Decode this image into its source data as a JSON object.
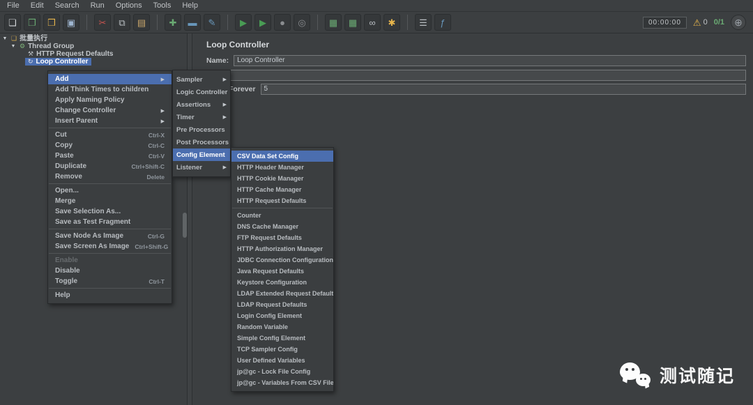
{
  "menubar": {
    "items": [
      {
        "name": "menu-file",
        "label": "File"
      },
      {
        "name": "menu-edit",
        "label": "Edit"
      },
      {
        "name": "menu-search",
        "label": "Search"
      },
      {
        "name": "menu-run",
        "label": "Run"
      },
      {
        "name": "menu-options",
        "label": "Options"
      },
      {
        "name": "menu-tools",
        "label": "Tools"
      },
      {
        "name": "menu-help",
        "label": "Help"
      }
    ]
  },
  "toolbar": {
    "timer": "00:00:00",
    "warning_count": "0",
    "threads": "0/1",
    "buttons": [
      {
        "name": "new-file-button",
        "icon": "new-file-icon",
        "glyph": "❏",
        "color": "#d4d7da"
      },
      {
        "name": "templates-button",
        "icon": "templates-icon",
        "glyph": "❐",
        "color": "#6aab73"
      },
      {
        "name": "open-file-button",
        "icon": "open-folder-icon",
        "glyph": "❒",
        "color": "#e8b64c"
      },
      {
        "name": "save-button",
        "icon": "save-icon",
        "glyph": "▣",
        "color": "#9fb6d0"
      },
      {
        "separator": true
      },
      {
        "name": "cut-button",
        "icon": "scissors-icon",
        "glyph": "✂",
        "color": "#c75450"
      },
      {
        "name": "copy-button",
        "icon": "copy-icon",
        "glyph": "⧉",
        "color": "#b9bec3"
      },
      {
        "name": "paste-button",
        "icon": "paste-icon",
        "glyph": "▤",
        "color": "#c9a66b"
      },
      {
        "separator": true
      },
      {
        "name": "add-button",
        "icon": "plus-icon",
        "glyph": "✚",
        "color": "#6aab73"
      },
      {
        "name": "remove-button",
        "icon": "minus-icon",
        "glyph": "▬",
        "color": "#6897bb"
      },
      {
        "name": "edit-button",
        "icon": "pencil-icon",
        "glyph": "✎",
        "color": "#6897bb"
      },
      {
        "separator": true
      },
      {
        "name": "start-button",
        "icon": "start-icon",
        "glyph": "▶",
        "color": "#499c54"
      },
      {
        "name": "start-no-pauses-button",
        "icon": "start-no-pauses-icon",
        "glyph": "▶",
        "color": "#499c54"
      },
      {
        "name": "stop-button",
        "icon": "stop-icon",
        "glyph": "●",
        "color": "#8a8d90"
      },
      {
        "name": "shutdown-button",
        "icon": "shutdown-icon",
        "glyph": "◎",
        "color": "#8a8d90"
      },
      {
        "separator": true
      },
      {
        "name": "remote-start-button",
        "icon": "remote-start-icon",
        "glyph": "▦",
        "color": "#6aab73"
      },
      {
        "name": "remote-start-all-button",
        "icon": "remote-start-all-icon",
        "glyph": "▦",
        "color": "#6aab73"
      },
      {
        "name": "search-button",
        "icon": "binoculars-icon",
        "glyph": "∞",
        "color": "#b9bec3"
      },
      {
        "name": "search-reset-button",
        "icon": "brush-icon",
        "glyph": "✱",
        "color": "#e8b64c"
      },
      {
        "separator": true
      },
      {
        "name": "clear-button",
        "icon": "clear-icon",
        "glyph": "☰",
        "color": "#b9bec3"
      },
      {
        "name": "function-helper-button",
        "icon": "function-helper-icon",
        "glyph": "ƒ",
        "color": "#6897bb"
      }
    ]
  },
  "icons": {
    "submenu_arrow": "▶",
    "warning": "⚠",
    "globe": "⊕"
  },
  "tree": {
    "items": [
      {
        "name": "tree-item-test-plan",
        "icon_name": "test-plan-icon",
        "twisty": "▼",
        "glyph": "❏",
        "color": "#d0a94f",
        "label": "批量执行",
        "indent": 0
      },
      {
        "name": "tree-item-thread-group",
        "icon_name": "thread-group-icon",
        "twisty": "▼",
        "glyph": "⚙",
        "color": "#7fb37a",
        "label": "Thread Group",
        "indent": 1
      },
      {
        "name": "tree-item-http-request-defaults",
        "icon_name": "http-request-defaults-icon",
        "twisty": "",
        "glyph": "⚒",
        "color": "#b9bec3",
        "label": "HTTP Request Defaults",
        "indent": 2
      },
      {
        "name": "tree-item-loop-controller",
        "icon_name": "loop-controller-icon",
        "twisty": "",
        "glyph": "↻",
        "color": "#e8e8e8",
        "label": "Loop Controller",
        "indent": 2,
        "selected": true
      }
    ]
  },
  "main": {
    "title": "Loop Controller",
    "name_label": "Name:",
    "name_value": "Loop Controller",
    "comments_value": "",
    "forever_label": "Forever",
    "loop_count_value": "5"
  },
  "context_menu": {
    "items": [
      {
        "name": "menu-item-add",
        "label": "Add",
        "submenu": true,
        "highlighted": true
      },
      {
        "name": "menu-item-add-think-times",
        "label": "Add Think Times to children"
      },
      {
        "name": "menu-item-apply-naming-policy",
        "label": "Apply Naming Policy"
      },
      {
        "name": "menu-item-change-controller",
        "label": "Change Controller",
        "submenu": true
      },
      {
        "name": "menu-item-insert-parent",
        "label": "Insert Parent",
        "submenu": true
      },
      {
        "separator": true
      },
      {
        "name": "menu-item-cut",
        "label": "Cut",
        "shortcut": "Ctrl-X"
      },
      {
        "name": "menu-item-copy",
        "label": "Copy",
        "shortcut": "Ctrl-C"
      },
      {
        "name": "menu-item-paste",
        "label": "Paste",
        "shortcut": "Ctrl-V"
      },
      {
        "name": "menu-item-duplicate",
        "label": "Duplicate",
        "shortcut": "Ctrl+Shift-C"
      },
      {
        "name": "menu-item-remove",
        "label": "Remove",
        "shortcut": "Delete"
      },
      {
        "separator": true
      },
      {
        "name": "menu-item-open",
        "label": "Open..."
      },
      {
        "name": "menu-item-merge",
        "label": "Merge"
      },
      {
        "name": "menu-item-save-selection-as",
        "label": "Save Selection As..."
      },
      {
        "name": "menu-item-save-as-test-fragment",
        "label": "Save as Test Fragment"
      },
      {
        "separator": true
      },
      {
        "name": "menu-item-save-node-as-image",
        "label": "Save Node As Image",
        "shortcut": "Ctrl-G"
      },
      {
        "name": "menu-item-save-screen-as-image",
        "label": "Save Screen As Image",
        "shortcut": "Ctrl+Shift-G"
      },
      {
        "separator": true
      },
      {
        "name": "menu-item-enable",
        "label": "Enable",
        "disabled": true
      },
      {
        "name": "menu-item-disable",
        "label": "Disable"
      },
      {
        "name": "menu-item-toggle",
        "label": "Toggle",
        "shortcut": "Ctrl-T"
      },
      {
        "separator": true
      },
      {
        "name": "menu-item-help",
        "label": "Help"
      }
    ]
  },
  "add_submenu": {
    "items": [
      {
        "name": "menu-item-sampler",
        "label": "Sampler",
        "submenu": true
      },
      {
        "name": "menu-item-logic-controller",
        "label": "Logic Controller",
        "submenu": true
      },
      {
        "name": "menu-item-assertions",
        "label": "Assertions",
        "submenu": true
      },
      {
        "name": "menu-item-timer",
        "label": "Timer",
        "submenu": true
      },
      {
        "name": "menu-item-pre-processors",
        "label": "Pre Processors",
        "submenu": true
      },
      {
        "name": "menu-item-post-processors",
        "label": "Post Processors",
        "submenu": true
      },
      {
        "name": "menu-item-config-element",
        "label": "Config Element",
        "submenu": true,
        "highlighted": true
      },
      {
        "name": "menu-item-listener",
        "label": "Listener",
        "submenu": true
      }
    ]
  },
  "config_submenu": {
    "items": [
      {
        "name": "menu-item-csv-data-set-config",
        "label": "CSV Data Set Config",
        "highlighted": true
      },
      {
        "name": "menu-item-http-header-manager",
        "label": "HTTP Header Manager"
      },
      {
        "name": "menu-item-http-cookie-manager",
        "label": "HTTP Cookie Manager"
      },
      {
        "name": "menu-item-http-cache-manager",
        "label": "HTTP Cache Manager"
      },
      {
        "name": "menu-item-http-request-defaults",
        "label": "HTTP Request Defaults"
      },
      {
        "separator": true
      },
      {
        "name": "menu-item-counter",
        "label": "Counter"
      },
      {
        "name": "menu-item-dns-cache-manager",
        "label": "DNS Cache Manager"
      },
      {
        "name": "menu-item-ftp-request-defaults",
        "label": "FTP Request Defaults"
      },
      {
        "name": "menu-item-http-authorization-manager",
        "label": "HTTP Authorization Manager"
      },
      {
        "name": "menu-item-jdbc-connection-configuration",
        "label": "JDBC Connection Configuration"
      },
      {
        "name": "menu-item-java-request-defaults",
        "label": "Java Request Defaults"
      },
      {
        "name": "menu-item-keystore-configuration",
        "label": "Keystore Configuration"
      },
      {
        "name": "menu-item-ldap-extended-request-defaults",
        "label": "LDAP Extended Request Defaults"
      },
      {
        "name": "menu-item-ldap-request-defaults",
        "label": "LDAP Request Defaults"
      },
      {
        "name": "menu-item-login-config-element",
        "label": "Login Config Element"
      },
      {
        "name": "menu-item-random-variable",
        "label": "Random Variable"
      },
      {
        "name": "menu-item-simple-config-element",
        "label": "Simple Config Element"
      },
      {
        "name": "menu-item-tcp-sampler-config",
        "label": "TCP Sampler Config"
      },
      {
        "name": "menu-item-user-defined-variables",
        "label": "User Defined Variables"
      },
      {
        "name": "menu-item-jpgc-lock-file-config",
        "label": "jp@gc - Lock File Config"
      },
      {
        "name": "menu-item-jpgc-variables-from-csv-file",
        "label": "jp@gc - Variables From CSV File"
      }
    ]
  },
  "watermark": {
    "text": "测试随记"
  }
}
